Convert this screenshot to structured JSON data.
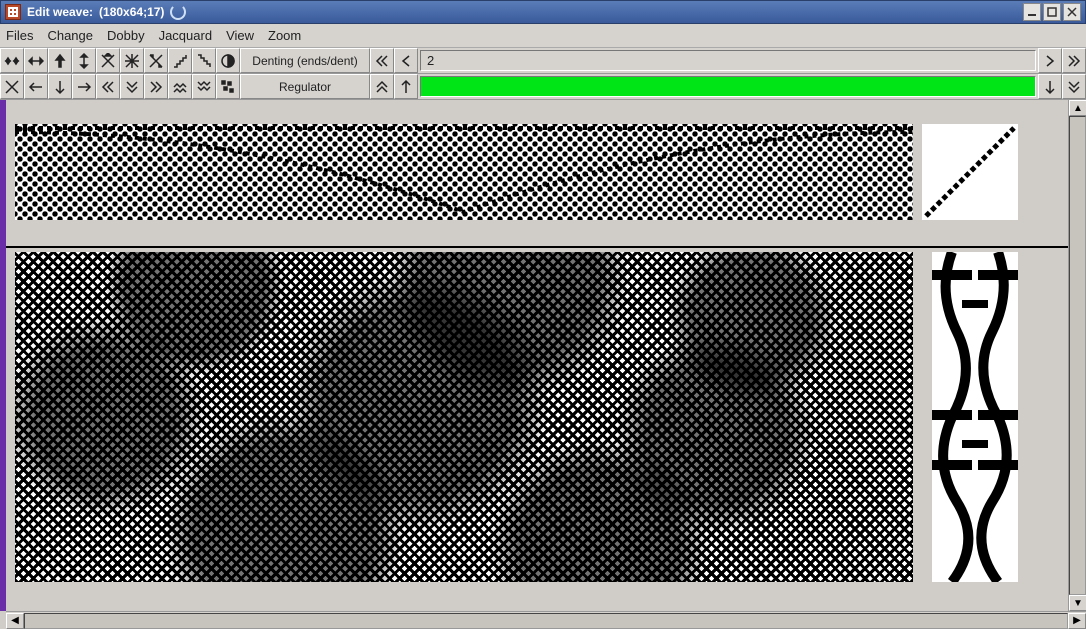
{
  "window": {
    "title": "Edit weave:",
    "title_extra": "(180x64;17)"
  },
  "menu": {
    "files": "Files",
    "change": "Change",
    "dobby": "Dobby",
    "jacquard": "Jacquard",
    "view": "View",
    "zoom": "Zoom"
  },
  "toolbar": {
    "row1": {
      "label": "Denting (ends/dent)",
      "input_value": "2"
    },
    "row2": {
      "label": "Regulator",
      "input_value": ""
    }
  },
  "colors": {
    "accent_green": "#00e515",
    "titlebar_blue": "#3a5a9a",
    "left_purple": "#6a2fa8",
    "warp_orange": "#f0a020"
  },
  "canvas": {
    "weave_size": "180x64",
    "shafts": 17
  }
}
